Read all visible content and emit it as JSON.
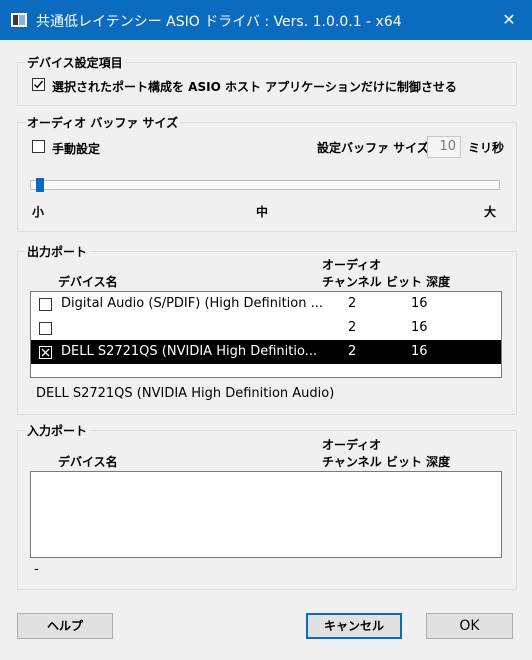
{
  "window": {
    "title": "共通低レイテンシー ASIO ドライバ : Vers. 1.0.0.1 - x64",
    "close_glyph": "✕"
  },
  "device_settings": {
    "group_label": "デバイス設定項目",
    "exclusive_checkbox_label": "選択されたポート構成を ASIO ホスト アプリケーションだけに制御させる",
    "exclusive_checked": true
  },
  "buffer": {
    "group_label": "オーディオ バッファ サイズ",
    "manual_label": "手動設定",
    "manual_checked": false,
    "size_label": "設定バッファ サイズ:",
    "size_value": "10",
    "unit": "ミリ秒",
    "slider_min_label": "小",
    "slider_mid_label": "中",
    "slider_max_label": "大",
    "slider_level": 0.02
  },
  "output": {
    "group_label": "出力ポート",
    "col_device": "デバイス名",
    "col_channels_line1": "オーディオ",
    "col_channels_line2": "チャンネル",
    "col_bits": "ビット 深度",
    "rows": [
      {
        "name": "Digital Audio (S/PDIF) (High Definition ...",
        "channels": "2",
        "bits": "16",
        "checked": false,
        "selected": false
      },
      {
        "name": "",
        "channels": "2",
        "bits": "16",
        "checked": false,
        "selected": false
      },
      {
        "name": "DELL S2721QS (NVIDIA High Definitio...",
        "channels": "2",
        "bits": "16",
        "checked": true,
        "selected": true
      }
    ],
    "selected_full_name": "DELL S2721QS (NVIDIA High Definition Audio)"
  },
  "input": {
    "group_label": "入力ポート",
    "col_device": "デバイス名",
    "col_channels_line1": "オーディオ",
    "col_channels_line2": "チャンネル",
    "col_bits": "ビット 深度",
    "selected_full_name": "-"
  },
  "buttons": {
    "help": "ヘルプ",
    "cancel": "キャンセル",
    "ok": "OK"
  },
  "colors": {
    "accent": "#0b6bbf"
  }
}
